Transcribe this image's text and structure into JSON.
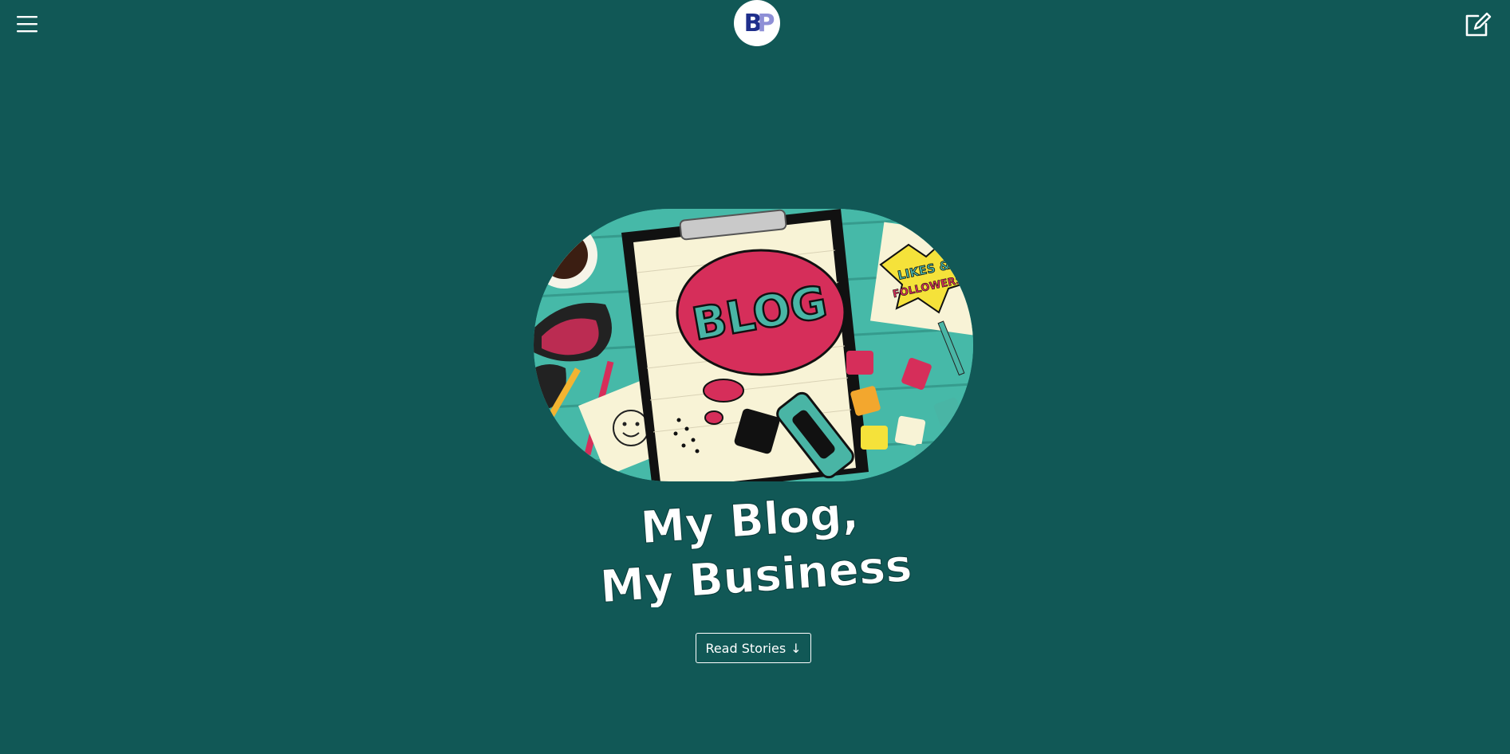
{
  "header": {
    "menu_icon": "hamburger-menu-icon",
    "logo_text": "BP",
    "logo_colors": [
      "#1f2f8c",
      "#8e8fd6"
    ],
    "edit_icon": "edit-note-icon"
  },
  "hero": {
    "image_label": "BLOG",
    "sticker_text": [
      "LIKES &",
      "FOLLOWERS"
    ],
    "title_line1": "My Blog,",
    "title_line2": "My Business",
    "cta_label": "Read Stories",
    "cta_arrow": "↓"
  },
  "colors": {
    "background": "#115856",
    "foreground": "#ffffff",
    "accent_pink": "#d62e5a",
    "accent_teal": "#3fb3a3"
  }
}
